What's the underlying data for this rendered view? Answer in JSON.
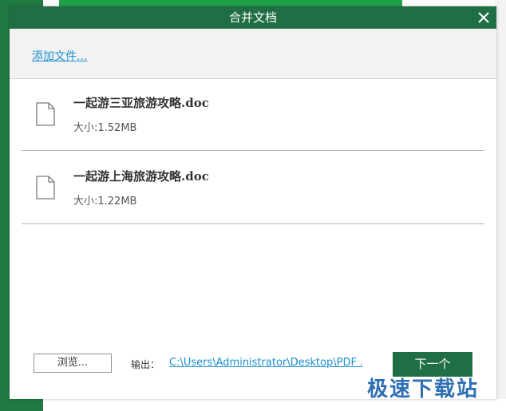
{
  "dialog": {
    "title": "合并文档",
    "add_files_label": "添加文件...",
    "files": [
      {
        "name": "一起游三亚旅游攻略.doc",
        "size": "大小:1.52MB"
      },
      {
        "name": "一起游上海旅游攻略.doc",
        "size": "大小:1.22MB"
      }
    ],
    "browse_label": "浏览...",
    "output_label": "输出：",
    "output_path": "C:\\Users\\Administrator\\Desktop\\PDF ...",
    "next_label": "下一个"
  },
  "watermark": "极速下载站",
  "colors": {
    "title_bar": "#1f6e44",
    "link": "#1a8fd0",
    "next_button": "#1f6e44",
    "background_app_green": "#1f7a41",
    "watermark": "#2f6fb3"
  },
  "icons": {
    "close": "close-icon",
    "file": "document-icon"
  }
}
